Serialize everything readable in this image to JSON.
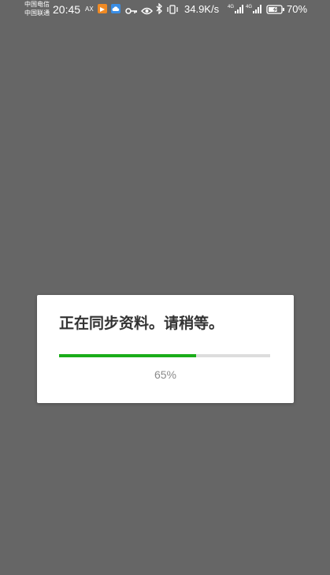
{
  "status_bar": {
    "carrier_1": "中国电信",
    "carrier_2": "中国联通",
    "time": "20:45",
    "ax_label": "AX",
    "net_speed": "34.9K/s",
    "signal_1_label": "4G",
    "signal_2_label": "4G",
    "battery": "70%",
    "battery_level": 0.7
  },
  "dialog": {
    "message": "正在同步资料。请稍等。",
    "progress_percent": 65,
    "progress_label": "65%",
    "accent_color": "#1aad19"
  }
}
